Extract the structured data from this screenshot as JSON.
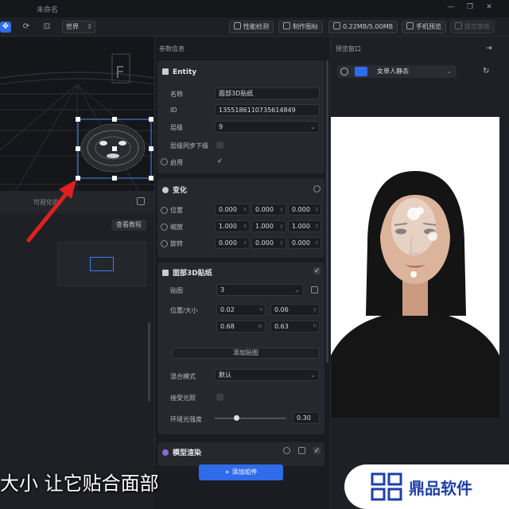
{
  "window": {
    "title": "未命名"
  },
  "toolbar": {
    "world_select": "世界",
    "perf_label": "性能检测",
    "icon_label": "制作图标",
    "size_label": "0.22MB/5.00MB",
    "phone_label": "手机预览",
    "submit_label": "提交审核"
  },
  "viewport": {
    "gizmo_letter": "F"
  },
  "left_panel": {
    "visual_label": "可视化的",
    "tutorial_label": "查看教程"
  },
  "props": {
    "title": "参数信息",
    "entity": {
      "head": "Entity",
      "name_label": "名称",
      "name_value": "面部3D贴纸",
      "id_label": "ID",
      "id_value": "1355186110735614849",
      "layer_label": "层级",
      "layer_value": "9",
      "sync_label": "层级同步下级",
      "enable_label": "启用"
    },
    "transform": {
      "head": "变化",
      "pos_label": "位置",
      "scale_label": "缩放",
      "rot_label": "旋转",
      "pos": [
        "0.000",
        "0.000",
        "0.000"
      ],
      "scale": [
        "1.000",
        "1.000",
        "1.000"
      ],
      "rot": [
        "0.000",
        "0.000",
        "0.000"
      ],
      "units": [
        "x",
        "y",
        "z"
      ]
    },
    "sticker": {
      "head": "面部3D贴纸",
      "map_label": "贴图",
      "map_value": "3",
      "possize_label": "位置/大小",
      "possize": [
        "0.02",
        "0.06",
        "0.68",
        "0.63"
      ],
      "possize_units": [
        "x",
        "y",
        "w",
        "h"
      ],
      "add_label": "添加贴图",
      "blend_label": "混合模式",
      "blend_value": "默认",
      "light_label": "接受光照",
      "ambient_label": "环境光强度",
      "ambient_value": "0.30",
      "ambient_fraction": 0.3
    },
    "model_render": {
      "head": "模型渲染"
    },
    "add_component": "+ 添加组件"
  },
  "preview": {
    "title": "预览窗口",
    "effect_select": "女单人静态"
  },
  "overlay": {
    "subtitle": "大小 让它贴合面部",
    "watermark": "鼎品软件"
  },
  "colors": {
    "accent": "#2f6bea",
    "annotation_arrow": "#e02020"
  }
}
